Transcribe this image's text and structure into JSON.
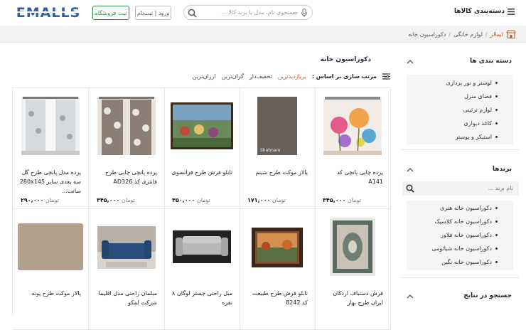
{
  "header": {
    "logo_text": "EMALLS",
    "seller_button": "ثبت فروشگاه",
    "login_button": "ورود | ثبت‌نام",
    "search_placeholder": "جستجوی نام، مدل یا برند کالا ...",
    "categories_label": "دسته‌بندی کالاها"
  },
  "breadcrumb": {
    "home": "ایمالز",
    "items": [
      "لوازم خانگی",
      "دکوراسیون خانه"
    ],
    "separator": "/"
  },
  "sidebar": {
    "categories_title": "دسته بندی ها",
    "categories": [
      "لوستر و نور پردازی",
      "فضای منزل",
      "لوازم تزئینی",
      "کاغذ دیواری",
      "استیکر و پوستر"
    ],
    "brands_title": "برندها",
    "brand_search_placeholder": "نام برند ...",
    "brands": [
      "دکوراسیون خانه هنری",
      "دکوراسیون خانه کلاسیک",
      "دکوراسیون خانه فلاور",
      "دکوراسیون خانه شیائومی",
      "دکوراسیون خانه نگین"
    ],
    "search_results_title": "جستجو در نتایج"
  },
  "main": {
    "title": "دکوراسیون خانه",
    "sort_label": "مرتب سازی بر اساس :",
    "sort_options": [
      "پربازدیدترین",
      "تخفیف‌دار",
      "گران‌ترین",
      "ارزان‌ترین"
    ],
    "products": [
      {
        "name": "پرده چاپی پانچی کد A141",
        "price": "۳۴۵,۰۰۰",
        "currency": "تومان",
        "image": "flower-curtain"
      },
      {
        "name": "پالاز موکت طرح شبنم",
        "price": "۱۷۱,۰۰۰",
        "currency": "تومان",
        "image": "gray-carpet"
      },
      {
        "name": "تابلو فرش طرح فرانسوی",
        "price": "۳۵۰,۰۰۰",
        "currency": "تومان",
        "image": "carpet-painting"
      },
      {
        "name": "پرده پانچی چاپی طرح فانتزی کد AD326",
        "price": "۳۴۵,۰۰۰",
        "currency": "تومان",
        "image": "fantasy-curtain"
      },
      {
        "name": "پرده مدل پانچی طرح گل سه بعدی سایز 280x145 سانت...",
        "price": "۲۹۰,۰۰۰",
        "currency": "تومان",
        "image": "white-curtain"
      },
      {
        "name": "فرش دستباف اردکان ایران طرح بهار",
        "price": "",
        "currency": "",
        "image": "persian-rug"
      },
      {
        "name": "تابلو فرش طرح طبیعت کد 8242",
        "price": "",
        "currency": "",
        "image": "nature-painting"
      },
      {
        "name": "مبل راحتی چستر لوگان ۸ نفره",
        "price": "",
        "currency": "",
        "image": "gray-sofa"
      },
      {
        "name": "مبلمان راحتی مدل اقلیما شرکت لمکو",
        "price": "",
        "currency": "",
        "image": "blue-sofa"
      },
      {
        "name": "پالاز موکت طرح پونه",
        "price": "",
        "currency": "",
        "image": "beige-carpet"
      }
    ]
  },
  "colors": {
    "logo_blue": "#2f5da8",
    "accent_orange": "#e0521c",
    "seller_green": "#2f8f3f"
  }
}
